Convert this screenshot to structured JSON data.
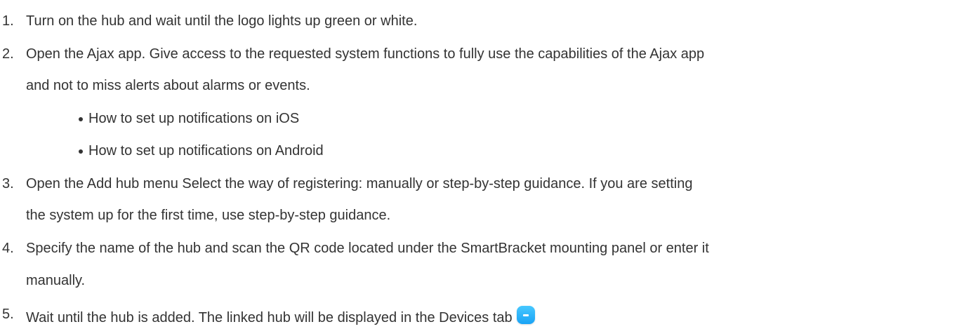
{
  "steps": [
    {
      "number": "1.",
      "lines": [
        "Turn on the hub and wait until the logo lights up green or white."
      ]
    },
    {
      "number": "2.",
      "lines": [
        "Open the Ajax app. Give access to the requested system functions to fully use the capabilities of the Ajax app",
        "and not to miss alerts about alarms or events."
      ],
      "bullets": [
        "How to set up notifications on iOS",
        "How to set up notifications on Android"
      ]
    },
    {
      "number": "3.",
      "lines": [
        "Open the Add hub menu Select the way of registering: manually or step-by-step guidance. If you are setting",
        "the system up for the first time, use step-by-step guidance."
      ]
    },
    {
      "number": "4.",
      "lines": [
        "Specify the name of the hub and scan the QR code located under the SmartBracket mounting panel or enter it",
        "manually."
      ]
    },
    {
      "number": "5.",
      "lines": [
        "Wait until the hub is added. The linked hub will be displayed in the Devices tab"
      ],
      "icon": "devices-tab-icon"
    }
  ],
  "colors": {
    "text": "#333333",
    "icon_blue": "#1aa3f5"
  }
}
